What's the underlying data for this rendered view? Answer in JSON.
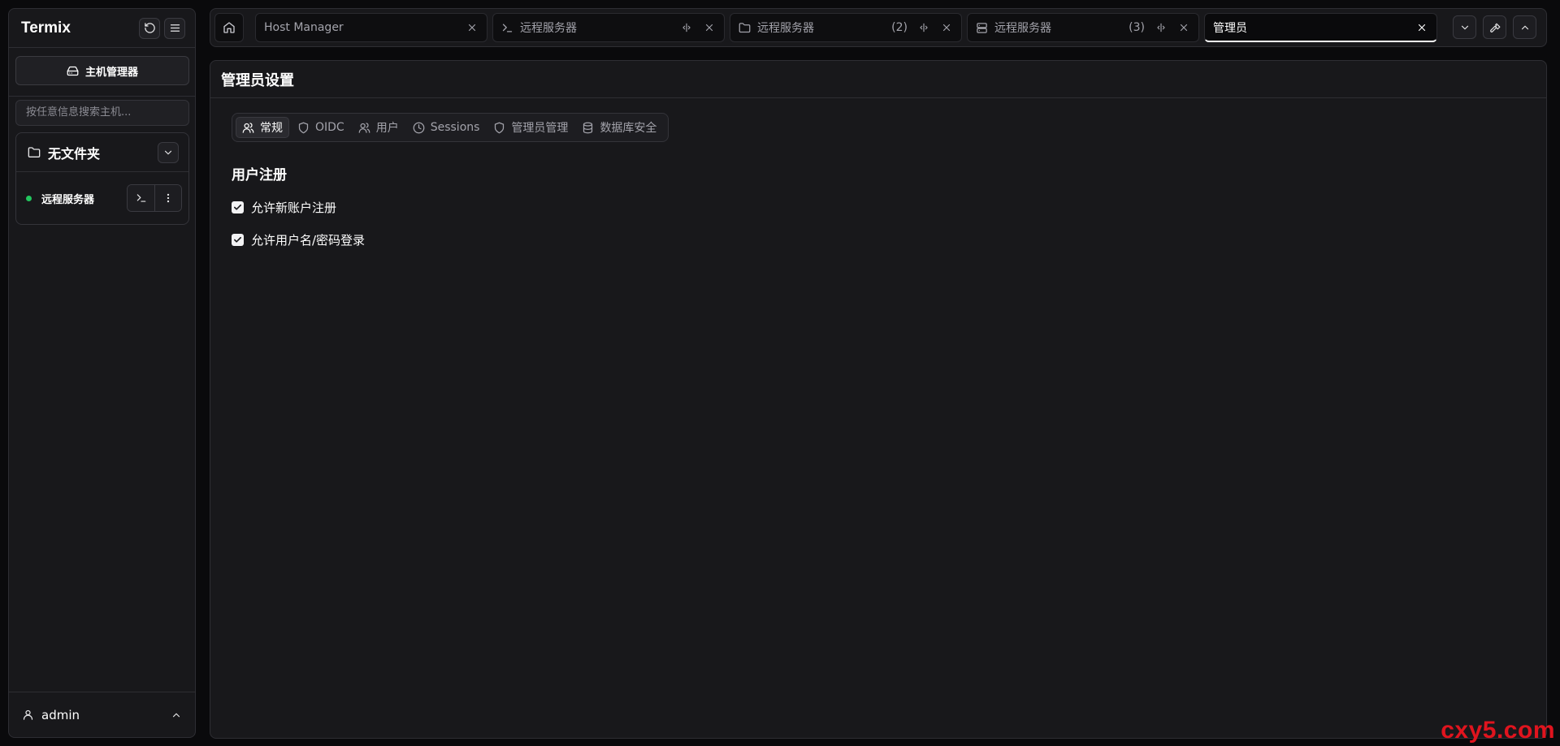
{
  "sidebar": {
    "brand": "Termix",
    "host_manager_label": "主机管理器",
    "search_placeholder": "按任意信息搜索主机...",
    "folder": {
      "title": "无文件夹",
      "hosts": [
        {
          "name": "远程服务器",
          "status": "online",
          "status_color": "#22c55e"
        }
      ]
    },
    "user": {
      "name": "admin"
    }
  },
  "tabs": [
    {
      "label": "Host Manager",
      "icon": "none",
      "count": "",
      "active": false
    },
    {
      "label": "远程服务器",
      "icon": "terminal-icon",
      "count": "",
      "active": false
    },
    {
      "label": "远程服务器",
      "icon": "folder-icon",
      "count": "(2)",
      "active": false
    },
    {
      "label": "远程服务器",
      "icon": "server-icon",
      "count": "(3)",
      "active": false
    },
    {
      "label": "管理员",
      "icon": "none",
      "count": "",
      "active": true
    }
  ],
  "main": {
    "title": "管理员设置",
    "subtabs": [
      {
        "label": "常规",
        "icon": "users-icon",
        "active": true
      },
      {
        "label": "OIDC",
        "icon": "shield-icon",
        "active": false
      },
      {
        "label": "用户",
        "icon": "users-icon",
        "active": false
      },
      {
        "label": "Sessions",
        "icon": "clock-icon",
        "active": false
      },
      {
        "label": "管理员管理",
        "icon": "shield-icon",
        "active": false
      },
      {
        "label": "数据库安全",
        "icon": "database-icon",
        "active": false
      }
    ],
    "section_title": "用户注册",
    "options": [
      {
        "label": "允许新账户注册",
        "checked": true
      },
      {
        "label": "允许用户名/密码登录",
        "checked": true
      }
    ]
  },
  "watermark": "cxy5.com"
}
